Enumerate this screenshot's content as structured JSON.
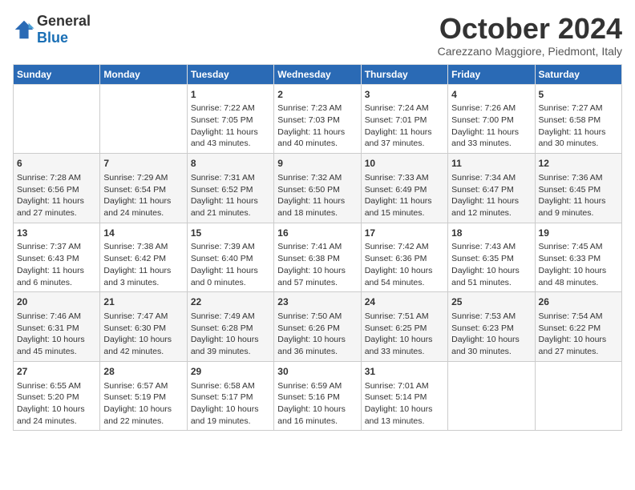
{
  "header": {
    "logo_general": "General",
    "logo_blue": "Blue",
    "month": "October 2024",
    "location": "Carezzano Maggiore, Piedmont, Italy"
  },
  "days_of_week": [
    "Sunday",
    "Monday",
    "Tuesday",
    "Wednesday",
    "Thursday",
    "Friday",
    "Saturday"
  ],
  "weeks": [
    [
      {
        "day": "",
        "content": ""
      },
      {
        "day": "",
        "content": ""
      },
      {
        "day": "1",
        "content": "Sunrise: 7:22 AM\nSunset: 7:05 PM\nDaylight: 11 hours and 43 minutes."
      },
      {
        "day": "2",
        "content": "Sunrise: 7:23 AM\nSunset: 7:03 PM\nDaylight: 11 hours and 40 minutes."
      },
      {
        "day": "3",
        "content": "Sunrise: 7:24 AM\nSunset: 7:01 PM\nDaylight: 11 hours and 37 minutes."
      },
      {
        "day": "4",
        "content": "Sunrise: 7:26 AM\nSunset: 7:00 PM\nDaylight: 11 hours and 33 minutes."
      },
      {
        "day": "5",
        "content": "Sunrise: 7:27 AM\nSunset: 6:58 PM\nDaylight: 11 hours and 30 minutes."
      }
    ],
    [
      {
        "day": "6",
        "content": "Sunrise: 7:28 AM\nSunset: 6:56 PM\nDaylight: 11 hours and 27 minutes."
      },
      {
        "day": "7",
        "content": "Sunrise: 7:29 AM\nSunset: 6:54 PM\nDaylight: 11 hours and 24 minutes."
      },
      {
        "day": "8",
        "content": "Sunrise: 7:31 AM\nSunset: 6:52 PM\nDaylight: 11 hours and 21 minutes."
      },
      {
        "day": "9",
        "content": "Sunrise: 7:32 AM\nSunset: 6:50 PM\nDaylight: 11 hours and 18 minutes."
      },
      {
        "day": "10",
        "content": "Sunrise: 7:33 AM\nSunset: 6:49 PM\nDaylight: 11 hours and 15 minutes."
      },
      {
        "day": "11",
        "content": "Sunrise: 7:34 AM\nSunset: 6:47 PM\nDaylight: 11 hours and 12 minutes."
      },
      {
        "day": "12",
        "content": "Sunrise: 7:36 AM\nSunset: 6:45 PM\nDaylight: 11 hours and 9 minutes."
      }
    ],
    [
      {
        "day": "13",
        "content": "Sunrise: 7:37 AM\nSunset: 6:43 PM\nDaylight: 11 hours and 6 minutes."
      },
      {
        "day": "14",
        "content": "Sunrise: 7:38 AM\nSunset: 6:42 PM\nDaylight: 11 hours and 3 minutes."
      },
      {
        "day": "15",
        "content": "Sunrise: 7:39 AM\nSunset: 6:40 PM\nDaylight: 11 hours and 0 minutes."
      },
      {
        "day": "16",
        "content": "Sunrise: 7:41 AM\nSunset: 6:38 PM\nDaylight: 10 hours and 57 minutes."
      },
      {
        "day": "17",
        "content": "Sunrise: 7:42 AM\nSunset: 6:36 PM\nDaylight: 10 hours and 54 minutes."
      },
      {
        "day": "18",
        "content": "Sunrise: 7:43 AM\nSunset: 6:35 PM\nDaylight: 10 hours and 51 minutes."
      },
      {
        "day": "19",
        "content": "Sunrise: 7:45 AM\nSunset: 6:33 PM\nDaylight: 10 hours and 48 minutes."
      }
    ],
    [
      {
        "day": "20",
        "content": "Sunrise: 7:46 AM\nSunset: 6:31 PM\nDaylight: 10 hours and 45 minutes."
      },
      {
        "day": "21",
        "content": "Sunrise: 7:47 AM\nSunset: 6:30 PM\nDaylight: 10 hours and 42 minutes."
      },
      {
        "day": "22",
        "content": "Sunrise: 7:49 AM\nSunset: 6:28 PM\nDaylight: 10 hours and 39 minutes."
      },
      {
        "day": "23",
        "content": "Sunrise: 7:50 AM\nSunset: 6:26 PM\nDaylight: 10 hours and 36 minutes."
      },
      {
        "day": "24",
        "content": "Sunrise: 7:51 AM\nSunset: 6:25 PM\nDaylight: 10 hours and 33 minutes."
      },
      {
        "day": "25",
        "content": "Sunrise: 7:53 AM\nSunset: 6:23 PM\nDaylight: 10 hours and 30 minutes."
      },
      {
        "day": "26",
        "content": "Sunrise: 7:54 AM\nSunset: 6:22 PM\nDaylight: 10 hours and 27 minutes."
      }
    ],
    [
      {
        "day": "27",
        "content": "Sunrise: 6:55 AM\nSunset: 5:20 PM\nDaylight: 10 hours and 24 minutes."
      },
      {
        "day": "28",
        "content": "Sunrise: 6:57 AM\nSunset: 5:19 PM\nDaylight: 10 hours and 22 minutes."
      },
      {
        "day": "29",
        "content": "Sunrise: 6:58 AM\nSunset: 5:17 PM\nDaylight: 10 hours and 19 minutes."
      },
      {
        "day": "30",
        "content": "Sunrise: 6:59 AM\nSunset: 5:16 PM\nDaylight: 10 hours and 16 minutes."
      },
      {
        "day": "31",
        "content": "Sunrise: 7:01 AM\nSunset: 5:14 PM\nDaylight: 10 hours and 13 minutes."
      },
      {
        "day": "",
        "content": ""
      },
      {
        "day": "",
        "content": ""
      }
    ]
  ]
}
